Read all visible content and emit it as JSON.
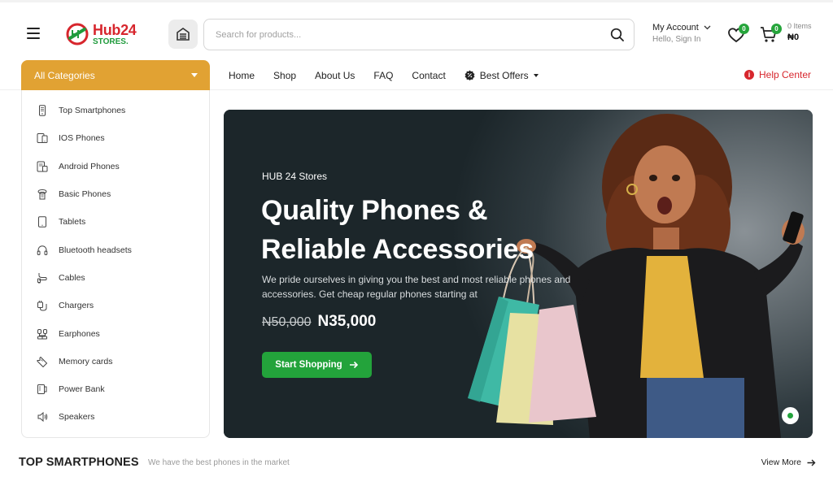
{
  "header": {
    "logo_name": "Hub24",
    "logo_sub": "STORES.",
    "search_placeholder": "Search for products...",
    "account_title": "My Account",
    "account_sub": "Hello, Sign In",
    "wishlist_count": "0",
    "cart_count": "0",
    "cart_items": "0 Items",
    "cart_total": "₦0"
  },
  "nav": {
    "categories_label": "All Categories",
    "links": [
      "Home",
      "Shop",
      "About Us",
      "FAQ",
      "Contact"
    ],
    "best_offers": "Best Offers",
    "help_center": "Help Center"
  },
  "categories": [
    {
      "label": "Top Smartphones",
      "icon": "smartphone-icon"
    },
    {
      "label": "IOS Phones",
      "icon": "ios-phone-icon"
    },
    {
      "label": "Android Phones",
      "icon": "android-phone-icon"
    },
    {
      "label": "Basic Phones",
      "icon": "basic-phone-icon"
    },
    {
      "label": "Tablets",
      "icon": "tablet-icon"
    },
    {
      "label": "Bluetooth headsets",
      "icon": "headset-icon"
    },
    {
      "label": "Cables",
      "icon": "cable-icon"
    },
    {
      "label": "Chargers",
      "icon": "charger-icon"
    },
    {
      "label": "Earphones",
      "icon": "earphones-icon"
    },
    {
      "label": "Memory cards",
      "icon": "memory-card-icon"
    },
    {
      "label": "Power Bank",
      "icon": "power-bank-icon"
    },
    {
      "label": "Speakers",
      "icon": "speaker-icon"
    }
  ],
  "hero": {
    "eyebrow": "HUB 24 Stores",
    "title_line1": "Quality Phones &",
    "title_line2": "Reliable Accessories",
    "description": "We pride ourselves in giving you the best and most reliable phones and accessories. Get cheap regular phones starting at",
    "old_price": "N50,000",
    "new_price": "N35,000",
    "cta": "Start Shopping"
  },
  "section": {
    "title": "TOP SMARTPHONES",
    "subtitle": "We have the best phones in the market",
    "view_more": "View More"
  },
  "colors": {
    "accent_orange": "#e1a233",
    "brand_green": "#23a33b",
    "brand_red": "#d7262d",
    "hero_bg": "#1c262a"
  }
}
